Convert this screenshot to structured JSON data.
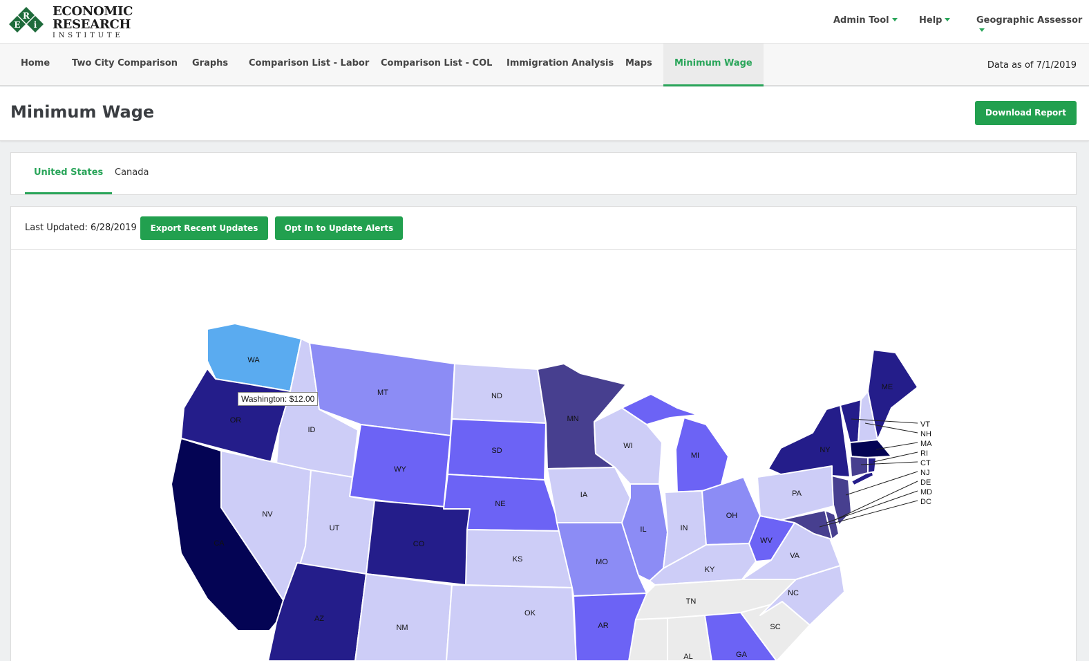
{
  "header": {
    "logo": {
      "line1": "ECONOMIC",
      "line2": "RESEARCH",
      "line3": "INSTITUTE",
      "letters": [
        "E",
        "R",
        "i"
      ]
    },
    "menus": [
      "Admin Tool",
      "Help",
      "Geographic Assessor"
    ]
  },
  "nav": {
    "items": [
      "Home",
      "Two City Comparison",
      "Graphs",
      "Comparison List - Labor",
      "Comparison List - COL",
      "Immigration Analysis",
      "Maps",
      "Minimum Wage"
    ],
    "active": "Minimum Wage",
    "data_as_of": "Data as of 7/1/2019"
  },
  "page": {
    "title": "Minimum Wage",
    "download_label": "Download Report"
  },
  "tabs": {
    "items": [
      "United States",
      "Canada"
    ],
    "active": "United States"
  },
  "toolbar": {
    "last_updated": "Last Updated: 6/28/2019",
    "export_label": "Export Recent Updates",
    "optin_label": "Opt In to Update Alerts"
  },
  "map": {
    "tooltip": "Washington: $12.00",
    "state_labels": [
      "WA",
      "OR",
      "CA",
      "ID",
      "NV",
      "MT",
      "WY",
      "UT",
      "AZ",
      "CO",
      "NM",
      "ND",
      "SD",
      "NE",
      "KS",
      "OK",
      "MN",
      "IA",
      "MO",
      "AR",
      "WI",
      "IL",
      "MI",
      "IN",
      "OH",
      "KY",
      "TN",
      "WV",
      "VA",
      "NC",
      "SC",
      "GA",
      "AL",
      "PA",
      "NY",
      "ME"
    ],
    "callout_labels": [
      "VT",
      "NH",
      "MA",
      "RI",
      "CT",
      "NJ",
      "DE",
      "MD",
      "DC"
    ]
  },
  "colors": {
    "accent": "#22a04f",
    "highlight": "#5aabf0",
    "scale": [
      "#ebebeb",
      "#cdcdf7",
      "#8c8cf5",
      "#6c63f5",
      "#473f8f",
      "#241d8a",
      "#040454"
    ]
  }
}
